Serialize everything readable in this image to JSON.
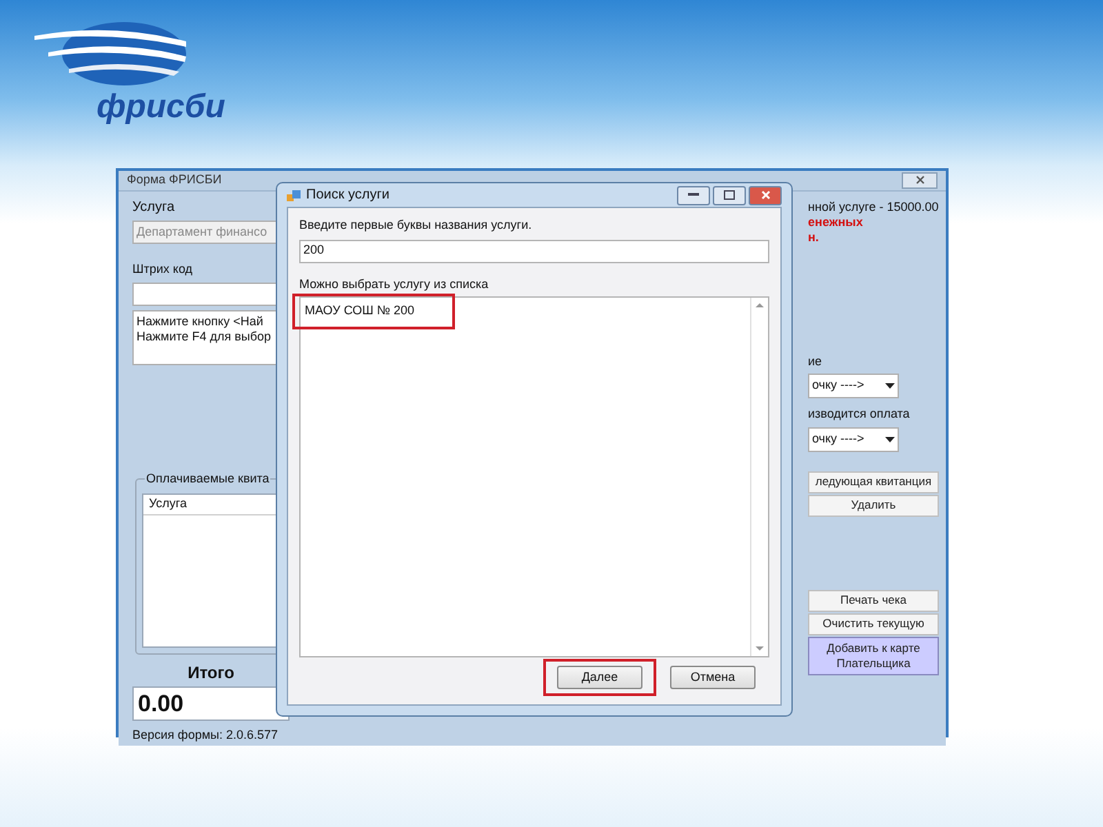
{
  "logo": {
    "text": "фрисби"
  },
  "main_window": {
    "title": "Форма ФРИСБИ",
    "service_label": "Услуга",
    "service_field": {
      "placeholder": "Департамент финансо"
    },
    "barcode_label": "Штрих код",
    "hint_lines": [
      "Нажмите кнопку <Най",
      "Нажмите F4 для выбор"
    ],
    "group": {
      "legend": "Оплачиваемые квита",
      "columns": [
        "Услуга"
      ]
    },
    "total_label": "Итого",
    "total_value": "0.00",
    "version": "Версия формы: 2.0.6.577",
    "info_lines": [
      {
        "text": "нной услуге - 15000.00",
        "kind": "normal"
      },
      {
        "text": "енежных",
        "kind": "warning"
      },
      {
        "text": "н.",
        "kind": "warning"
      }
    ],
    "combos": [
      {
        "label": "ие",
        "value": "очку ---->"
      },
      {
        "label": "изводится оплата",
        "value": "очку ---->"
      }
    ],
    "buttons_top": [
      {
        "label": "ледующая квитанция"
      },
      {
        "label": "Удалить"
      }
    ],
    "buttons_bottom": [
      {
        "label": "Печать чека",
        "kind": "plain"
      },
      {
        "label": "Очистить текущую",
        "kind": "plain"
      },
      {
        "label": "Добавить к карте Плательщика",
        "kind": "accent"
      }
    ]
  },
  "dialog": {
    "title": "Поиск услуги",
    "prompt": "Введите первые буквы названия услуги.",
    "search_field": {
      "value": "200"
    },
    "list_label": "Можно выбрать услугу из списка",
    "items": [
      {
        "text": "МАОУ СОШ № 200",
        "highlighted": true
      }
    ],
    "buttons": [
      {
        "label": "Далее",
        "highlighted": true
      },
      {
        "label": "Отмена",
        "highlighted": false
      }
    ]
  }
}
